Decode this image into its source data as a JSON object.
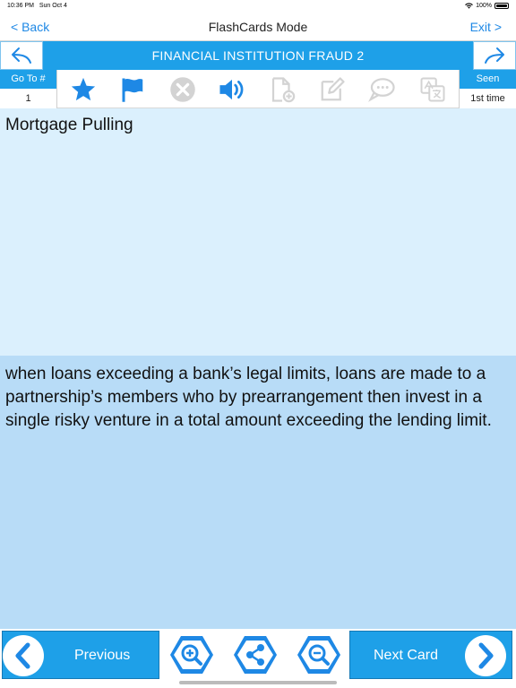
{
  "status_bar": {
    "time": "10:36 PM",
    "date": "Sun Oct 4",
    "battery": "100%"
  },
  "navbar": {
    "back_label": "< Back",
    "title": "FlashCards Mode",
    "exit_label": "Exit >"
  },
  "deck": {
    "title": "FINANCIAL INSTITUTION FRAUD 2"
  },
  "toolbar": {
    "goto_label": "Go To #",
    "goto_value": "1",
    "seen_label": "Seen",
    "seen_value": "1st time",
    "icons": [
      "star-icon",
      "flag-icon",
      "close-circle-icon",
      "speaker-icon",
      "add-file-icon",
      "edit-icon",
      "chat-icon",
      "translate-icon"
    ]
  },
  "card": {
    "question": "Mortgage Pulling",
    "answer": "when  loans exceeding a bank’s legal limits, loans are made to a partnership’s members who by prearrangement then invest in a single risky venture in a total amount exceeding the lending limit."
  },
  "bottom": {
    "previous_label": "Previous",
    "next_label": "Next Card"
  },
  "colors": {
    "accent": "#1ea0e8",
    "question_bg": "#dbf0fd",
    "answer_bg": "#b8dcf7",
    "link": "#1e88e5",
    "disabled_icon": "#d3d3d3"
  }
}
